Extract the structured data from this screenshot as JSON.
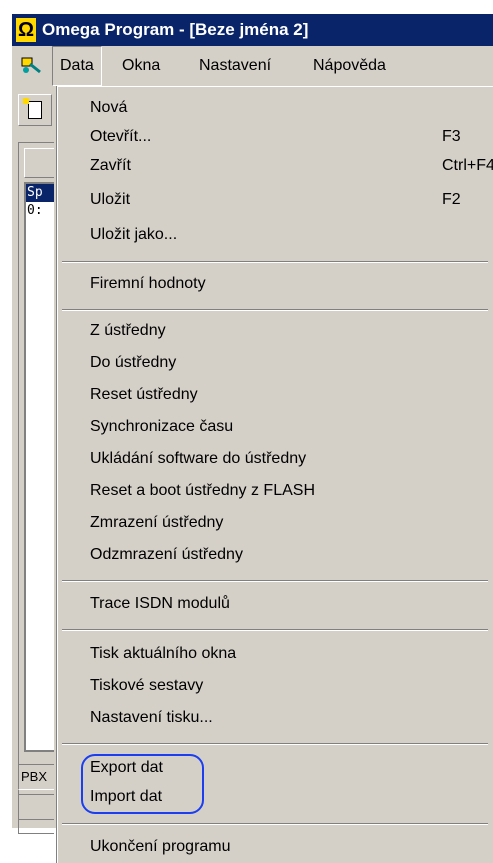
{
  "window": {
    "title": "Omega Program - [Beze jména 2]"
  },
  "menubar": {
    "items": [
      {
        "label": "Data"
      },
      {
        "label": "Okna"
      },
      {
        "label": "Nastavení"
      },
      {
        "label": "Nápověda"
      }
    ]
  },
  "left_panel": {
    "list_items": [
      "Sp",
      "0:"
    ],
    "status_text": "PBX"
  },
  "data_menu": {
    "items": [
      {
        "label": "Nová",
        "shortcut": ""
      },
      {
        "label": "Otevřít...",
        "shortcut": "F3"
      },
      {
        "label": "Zavřít",
        "shortcut": "Ctrl+F4"
      },
      {
        "label": "Uložit",
        "shortcut": "F2"
      },
      {
        "label": "Uložit jako...",
        "shortcut": ""
      },
      {
        "label": "Firemní hodnoty",
        "shortcut": ""
      },
      {
        "label": "Z ústředny",
        "shortcut": ""
      },
      {
        "label": "Do ústředny",
        "shortcut": ""
      },
      {
        "label": "Reset ústředny",
        "shortcut": ""
      },
      {
        "label": "Synchronizace času",
        "shortcut": ""
      },
      {
        "label": "Ukládání software do ústředny",
        "shortcut": ""
      },
      {
        "label": "Reset a boot ústředny z FLASH",
        "shortcut": ""
      },
      {
        "label": "Zmrazení ústředny",
        "shortcut": ""
      },
      {
        "label": "Odzmrazení ústředny",
        "shortcut": ""
      },
      {
        "label": "Trace ISDN modulů",
        "shortcut": ""
      },
      {
        "label": "Tisk aktuálního okna",
        "shortcut": ""
      },
      {
        "label": "Tiskové sestavy",
        "shortcut": "",
        "submenu": true
      },
      {
        "label": "Nastavení tisku...",
        "shortcut": ""
      },
      {
        "label": "Export dat",
        "shortcut": ""
      },
      {
        "label": "Import dat",
        "shortcut": ""
      },
      {
        "label": "Ukončení programu",
        "shortcut": ""
      }
    ]
  },
  "colors": {
    "titlebar": "#0a246a",
    "face": "#d4d0c8",
    "annotation_ring": "#1a3ef0"
  }
}
